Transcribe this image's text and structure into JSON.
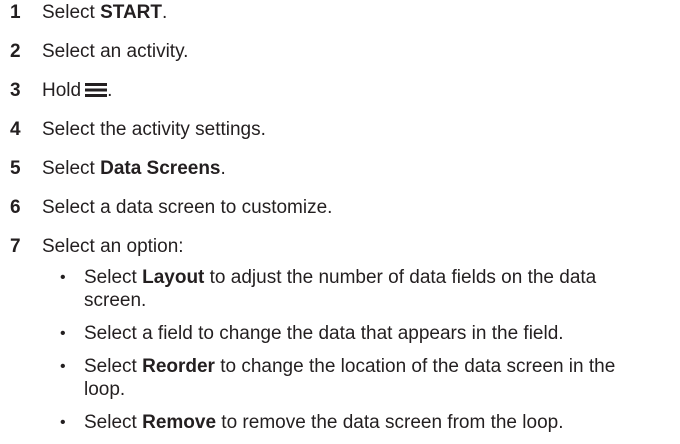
{
  "steps": [
    {
      "num": "1",
      "pre": "Select ",
      "bold": "START",
      "post": "."
    },
    {
      "num": "2",
      "pre": "Select an activity.",
      "bold": "",
      "post": ""
    },
    {
      "num": "3",
      "pre": "Hold",
      "bold": "",
      "post": "."
    },
    {
      "num": "4",
      "pre": "Select the activity settings.",
      "bold": "",
      "post": ""
    },
    {
      "num": "5",
      "pre": "Select ",
      "bold": "Data Screens",
      "post": "."
    },
    {
      "num": "6",
      "pre": "Select a data screen to customize.",
      "bold": "",
      "post": ""
    },
    {
      "num": "7",
      "pre": "Select an option:",
      "bold": "",
      "post": ""
    }
  ],
  "icons": {
    "menu": "menu-icon"
  },
  "bullets": [
    {
      "pre": "Select ",
      "bold": "Layout",
      "post": " to adjust the number of data fields on the data screen."
    },
    {
      "pre": "Select a field to change the data that appears in the field.",
      "bold": "",
      "post": ""
    },
    {
      "pre": "Select ",
      "bold": "Reorder",
      "post": " to change the location of the data screen in the loop."
    },
    {
      "pre": "Select ",
      "bold": "Remove",
      "post": " to remove the data screen from the loop."
    }
  ],
  "bullet_char": "•"
}
